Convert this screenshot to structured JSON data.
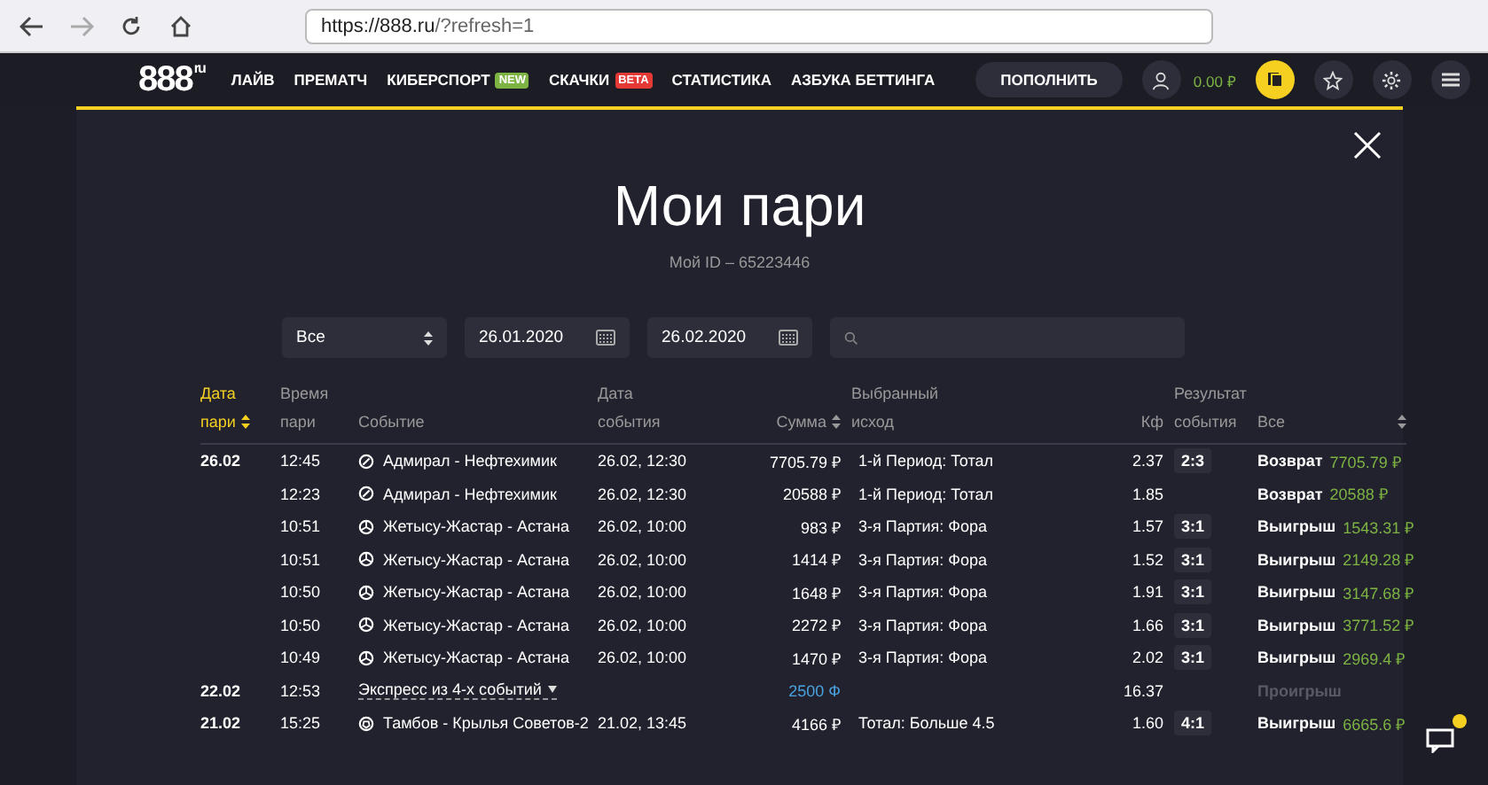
{
  "browser": {
    "url_host": "https://888.ru",
    "url_rest": "/?refresh=1"
  },
  "header": {
    "logo": "888",
    "logo_suffix": "ru",
    "nav": [
      {
        "label": "ЛАЙВ"
      },
      {
        "label": "ПРЕМАТЧ"
      },
      {
        "label": "КИБЕРСПОРТ",
        "badge": "NEW",
        "color": "#7cb342"
      },
      {
        "label": "СКАЧКИ",
        "badge": "BETA",
        "color": "#e53935"
      },
      {
        "label": "СТАТИСТИКА"
      },
      {
        "label": "АЗБУКА БЕТТИНГА"
      }
    ],
    "deposit": "ПОПОЛНИТЬ",
    "balance": "0.00 ₽"
  },
  "page": {
    "title": "Мои пари",
    "user_id": "Мой ID – 65223446"
  },
  "filters": {
    "type": "Все",
    "date_from": "26.01.2020",
    "date_to": "26.02.2020"
  },
  "table": {
    "columns": [
      {
        "line1": "Дата",
        "line2": "пари",
        "sortable": true,
        "active": true
      },
      {
        "line1": "Время",
        "line2": "пари",
        "sortable": false,
        "active": false
      },
      {
        "line2": "Событие",
        "sortable": false,
        "active": false
      },
      {
        "line1": "Дата",
        "line2": "события",
        "sortable": false,
        "active": false
      },
      {
        "line2": "Сумма",
        "sortable": true,
        "active": false
      },
      {
        "line1": "Выбранный",
        "line2": "исход",
        "sortable": false,
        "active": false
      },
      {
        "line2": "Кф",
        "sortable": false,
        "active": false
      },
      {
        "line1": "Результат",
        "line2": "события",
        "sortable": false,
        "active": false
      },
      {
        "line2": "Все",
        "sortable": true,
        "active": false
      }
    ],
    "rows": [
      {
        "date": "26.02",
        "time": "12:45",
        "kind": "hockey",
        "event": "Адмирал - Нефтехимик",
        "event_date": "26.02, 12:30",
        "amount": "7705.79 ₽",
        "outcome": "1-й Период: Тотал",
        "kf": "2.37",
        "score": "2:3",
        "status": "Возврат",
        "lost": false,
        "payout": "7705.79 ₽"
      },
      {
        "time": "12:23",
        "kind": "hockey",
        "event": "Адмирал - Нефтехимик",
        "event_date": "26.02, 12:30",
        "amount": "20588 ₽",
        "outcome": "1-й Период: Тотал",
        "kf": "1.85",
        "status": "Возврат",
        "lost": false,
        "payout": "20588 ₽"
      },
      {
        "time": "10:51",
        "kind": "volleyball",
        "event": "Жетысу-Жастар - Астана",
        "event_date": "26.02, 10:00",
        "amount": "983 ₽",
        "outcome": "3-я Партия: Фора",
        "kf": "1.57",
        "score": "3:1",
        "status": "Выигрыш",
        "lost": false,
        "payout": "1543.31 ₽"
      },
      {
        "time": "10:51",
        "kind": "volleyball",
        "event": "Жетысу-Жастар - Астана",
        "event_date": "26.02, 10:00",
        "amount": "1414 ₽",
        "outcome": "3-я Партия: Фора",
        "kf": "1.52",
        "score": "3:1",
        "status": "Выигрыш",
        "lost": false,
        "payout": "2149.28 ₽"
      },
      {
        "time": "10:50",
        "kind": "volleyball",
        "event": "Жетысу-Жастар - Астана",
        "event_date": "26.02, 10:00",
        "amount": "1648 ₽",
        "outcome": "3-я Партия: Фора",
        "kf": "1.91",
        "score": "3:1",
        "status": "Выигрыш",
        "lost": false,
        "payout": "3147.68 ₽"
      },
      {
        "time": "10:50",
        "kind": "volleyball",
        "event": "Жетысу-Жастар - Астана",
        "event_date": "26.02, 10:00",
        "amount": "2272 ₽",
        "outcome": "3-я Партия: Фора",
        "kf": "1.66",
        "score": "3:1",
        "status": "Выигрыш",
        "lost": false,
        "payout": "3771.52 ₽"
      },
      {
        "time": "10:49",
        "kind": "volleyball",
        "event": "Жетысу-Жастар - Астана",
        "event_date": "26.02, 10:00",
        "amount": "1470 ₽",
        "outcome": "3-я Партия: Фора",
        "kf": "2.02",
        "score": "3:1",
        "status": "Выигрыш",
        "lost": false,
        "payout": "2969.4 ₽"
      },
      {
        "date": "22.02",
        "time": "12:53",
        "kind": "express",
        "event": "Экспресс из 4-х событий",
        "amount": "2500 Ф",
        "kf": "16.37",
        "status": "Проигрыш",
        "lost": true
      },
      {
        "date": "21.02",
        "time": "15:25",
        "kind": "football",
        "event": "Тамбов - Крылья Советов-2",
        "event_date": "21.02, 13:45",
        "amount": "4166 ₽",
        "outcome": "Тотал: Больше 4.5",
        "kf": "1.60",
        "score": "4:1",
        "status": "Выигрыш",
        "lost": false,
        "payout": "6665.6 ₽"
      }
    ]
  }
}
